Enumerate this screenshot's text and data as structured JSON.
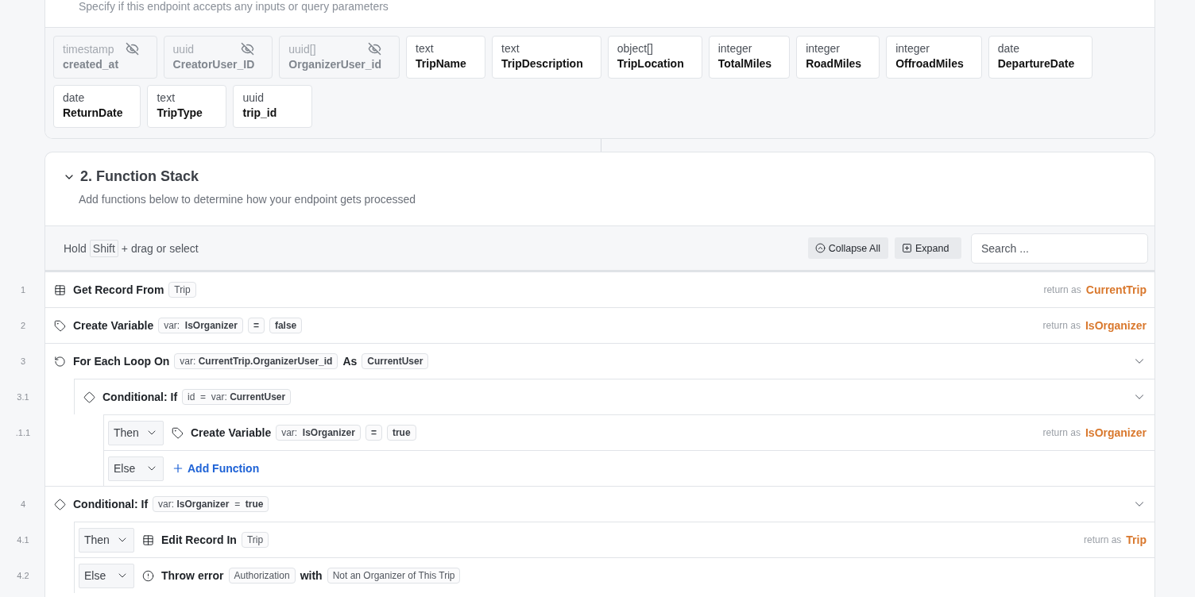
{
  "inputs_section": {
    "description": "Specify if this endpoint accepts any inputs or query parameters",
    "fields": [
      {
        "type": "timestamp",
        "name": "created_at",
        "hidden": true
      },
      {
        "type": "uuid",
        "name": "CreatorUser_ID",
        "hidden": true
      },
      {
        "type": "uuid[]",
        "name": "OrganizerUser_id",
        "hidden": true
      },
      {
        "type": "text",
        "name": "TripName",
        "hidden": false
      },
      {
        "type": "text",
        "name": "TripDescription",
        "hidden": false
      },
      {
        "type": "object[]",
        "name": "TripLocation",
        "hidden": false
      },
      {
        "type": "integer",
        "name": "TotalMiles",
        "hidden": false
      },
      {
        "type": "integer",
        "name": "RoadMiles",
        "hidden": false
      },
      {
        "type": "integer",
        "name": "OffroadMiles",
        "hidden": false
      },
      {
        "type": "date",
        "name": "DepartureDate",
        "hidden": false
      },
      {
        "type": "date",
        "name": "ReturnDate",
        "hidden": false
      },
      {
        "type": "text",
        "name": "TripType",
        "hidden": false
      },
      {
        "type": "uuid",
        "name": "trip_id",
        "hidden": false
      }
    ]
  },
  "function_stack": {
    "title": "2. Function Stack",
    "expanded": true,
    "description": "Add functions below to determine how your endpoint gets processed",
    "toolbar": {
      "hint_before": "Hold",
      "key": "Shift",
      "hint_after": "+ drag or select",
      "collapse_button": "Collapse All",
      "expand_button": "Expand",
      "search": {
        "placeholder": "Search ..."
      }
    },
    "steps": [
      {
        "kind": "get_record",
        "number": "1",
        "title": "Get Record From",
        "tokens": [
          {
            "kind": "chip",
            "text": "Trip"
          }
        ],
        "return_label": "return as",
        "return_value": "CurrentTrip"
      },
      {
        "kind": "create_variable",
        "number": "2",
        "title": "Create Variable",
        "tokens": [
          {
            "kind": "chip",
            "text": "var:  **IsOrganizer**"
          },
          {
            "kind": "chip",
            "text": "**=**"
          },
          {
            "kind": "chip",
            "text": "**false**"
          }
        ],
        "return_label": "return as",
        "return_value": "IsOrganizer"
      },
      {
        "kind": "loop",
        "number": "3",
        "title": "For Each Loop On",
        "tokens": [
          {
            "kind": "chip",
            "text": "var: **CurrentTrip.OrganizerUser_id**"
          },
          {
            "kind": "word",
            "text": "As"
          },
          {
            "kind": "chip",
            "text": "**CurrentUser**"
          }
        ],
        "expanded": true,
        "children": [
          {
            "kind": "conditional",
            "number": "3.1",
            "title": "Conditional: If",
            "tokens": [
              {
                "kind": "chip",
                "text": "id  =  var: **CurrentUser**"
              }
            ],
            "expanded": true,
            "children": [
              {
                "kind": "create_variable",
                "number": ".1.1",
                "branch": "Then",
                "title": "Create Variable",
                "tokens": [
                  {
                    "kind": "chip",
                    "text": "var:  **IsOrganizer**"
                  },
                  {
                    "kind": "chip",
                    "text": "**=**"
                  },
                  {
                    "kind": "chip",
                    "text": "**true**"
                  }
                ],
                "return_label": "return as",
                "return_value": "IsOrganizer"
              },
              {
                "kind": "add_function",
                "branch": "Else",
                "title": "Add Function"
              }
            ]
          }
        ]
      },
      {
        "kind": "conditional",
        "number": "4",
        "title": "Conditional: If",
        "tokens": [
          {
            "kind": "chip",
            "text": "var: **IsOrganizer**  =  **true**"
          }
        ],
        "expanded": true,
        "children": [
          {
            "kind": "edit_record",
            "number": "4.1",
            "branch": "Then",
            "title": "Edit Record In",
            "tokens": [
              {
                "kind": "chip",
                "text": "Trip"
              }
            ],
            "return_label": "return as",
            "return_value": "Trip"
          },
          {
            "kind": "throw_error",
            "number": "4.2",
            "branch": "Else",
            "title": "Throw error",
            "tokens": [
              {
                "kind": "chip",
                "text": "Authorization"
              },
              {
                "kind": "word",
                "text": "with"
              },
              {
                "kind": "chip",
                "text": "Not an Organizer of This Trip"
              }
            ]
          }
        ]
      }
    ]
  }
}
